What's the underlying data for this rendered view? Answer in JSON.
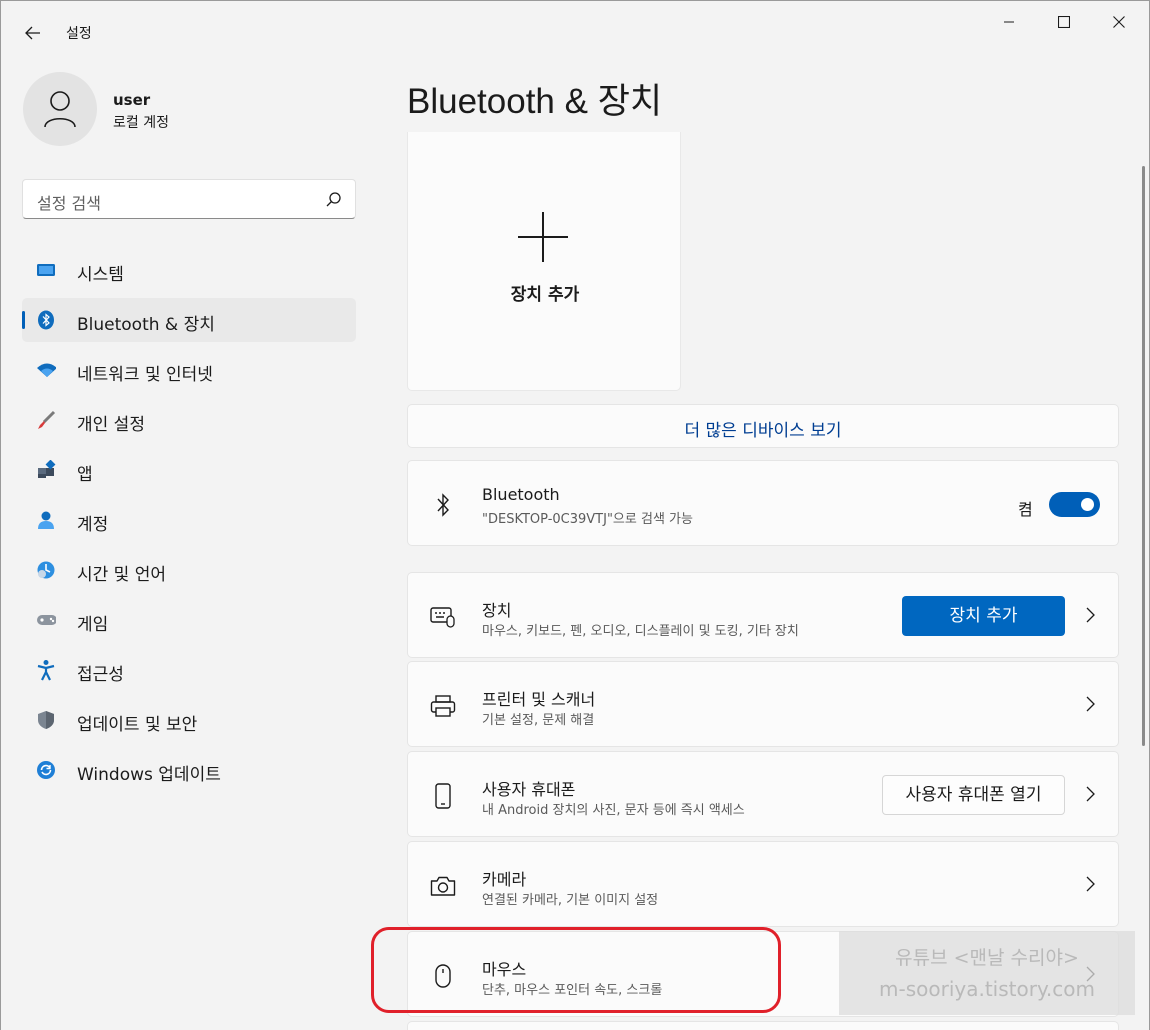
{
  "window": {
    "title": "설정"
  },
  "user": {
    "name": "user",
    "account_type": "로컬 계정"
  },
  "search": {
    "placeholder": "설정 검색"
  },
  "nav": [
    {
      "label": "시스템",
      "icon": "monitor-icon"
    },
    {
      "label": "Bluetooth & 장치",
      "icon": "bluetooth-icon",
      "selected": true
    },
    {
      "label": "네트워크 및 인터넷",
      "icon": "wifi-icon"
    },
    {
      "label": "개인 설정",
      "icon": "paintbrush-icon"
    },
    {
      "label": "앱",
      "icon": "apps-icon"
    },
    {
      "label": "계정",
      "icon": "person-icon"
    },
    {
      "label": "시간 및 언어",
      "icon": "clock-globe-icon"
    },
    {
      "label": "게임",
      "icon": "gamepad-icon"
    },
    {
      "label": "접근성",
      "icon": "accessibility-icon"
    },
    {
      "label": "업데이트 및 보안",
      "icon": "shield-icon"
    },
    {
      "label": "Windows 업데이트",
      "icon": "refresh-icon"
    }
  ],
  "main": {
    "title": "Bluetooth & 장치",
    "add_tile_label": "장치 추가",
    "more_devices_link": "더 많은 디바이스 보기",
    "bluetooth": {
      "title": "Bluetooth",
      "subtitle": "\"DESKTOP-0C39VTJ\"으로 검색 가능",
      "state_label": "켬",
      "on": true
    },
    "devices": {
      "title": "장치",
      "subtitle": "마우스, 키보드, 펜, 오디오, 디스플레이 및 도킹, 기타 장치",
      "button": "장치 추가"
    },
    "printers": {
      "title": "프린터 및 스캐너",
      "subtitle": "기본 설정, 문제 해결"
    },
    "phone": {
      "title": "사용자 휴대폰",
      "subtitle": "내 Android 장치의 사진, 문자 등에 즉시 액세스",
      "button": "사용자 휴대폰 열기"
    },
    "camera": {
      "title": "카메라",
      "subtitle": "연결된 카메라, 기본 이미지 설정"
    },
    "mouse": {
      "title": "마우스",
      "subtitle": "단추, 마우스 포인터 속도, 스크롤"
    }
  },
  "watermark": {
    "line1": "유튜브 <맨날 수리야>",
    "line2": "m-sooriya.tistory.com"
  },
  "colors": {
    "accent": "#0067c0",
    "highlight": "#e0202a",
    "link": "#003e92"
  }
}
